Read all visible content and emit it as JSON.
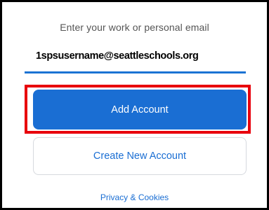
{
  "signin": {
    "prompt": "Enter your work or personal email",
    "email_value": "1spsusername@seattleschools.org",
    "add_account_label": "Add Account",
    "create_account_label": "Create New Account",
    "privacy_label": "Privacy & Cookies"
  },
  "colors": {
    "accent_blue": "#1a6ed3",
    "highlight_red": "#e8000c",
    "frame_black": "#000000"
  }
}
